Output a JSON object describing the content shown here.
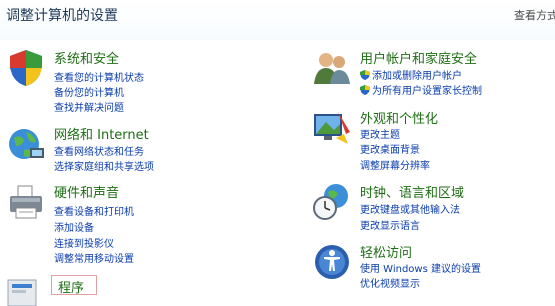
{
  "header": {
    "title": "调整计算机的设置",
    "view_by": "查看方式"
  },
  "categories": {
    "system_security": {
      "title": "系统和安全",
      "links": [
        "查看您的计算机状态",
        "备份您的计算机",
        "查找并解决问题"
      ]
    },
    "network": {
      "title": "网络和 Internet",
      "links": [
        "查看网络状态和任务",
        "选择家庭组和共享选项"
      ]
    },
    "hardware": {
      "title": "硬件和声音",
      "links": [
        "查看设备和打印机",
        "添加设备",
        "连接到投影仪",
        "调整常用移动设置"
      ]
    },
    "programs": {
      "title": "程序"
    },
    "user_accounts": {
      "title": "用户帐户和家庭安全",
      "links": [
        "添加或删除用户帐户",
        "为所有用户设置家长控制"
      ]
    },
    "appearance": {
      "title": "外观和个性化",
      "links": [
        "更改主题",
        "更改桌面背景",
        "调整屏幕分辨率"
      ]
    },
    "clock": {
      "title": "时钟、语言和区域",
      "links": [
        "更改键盘或其他输入法",
        "更改显示语言"
      ]
    },
    "ease": {
      "title": "轻松访问",
      "links": [
        "使用 Windows 建议的设置",
        "优化视频显示"
      ]
    }
  }
}
